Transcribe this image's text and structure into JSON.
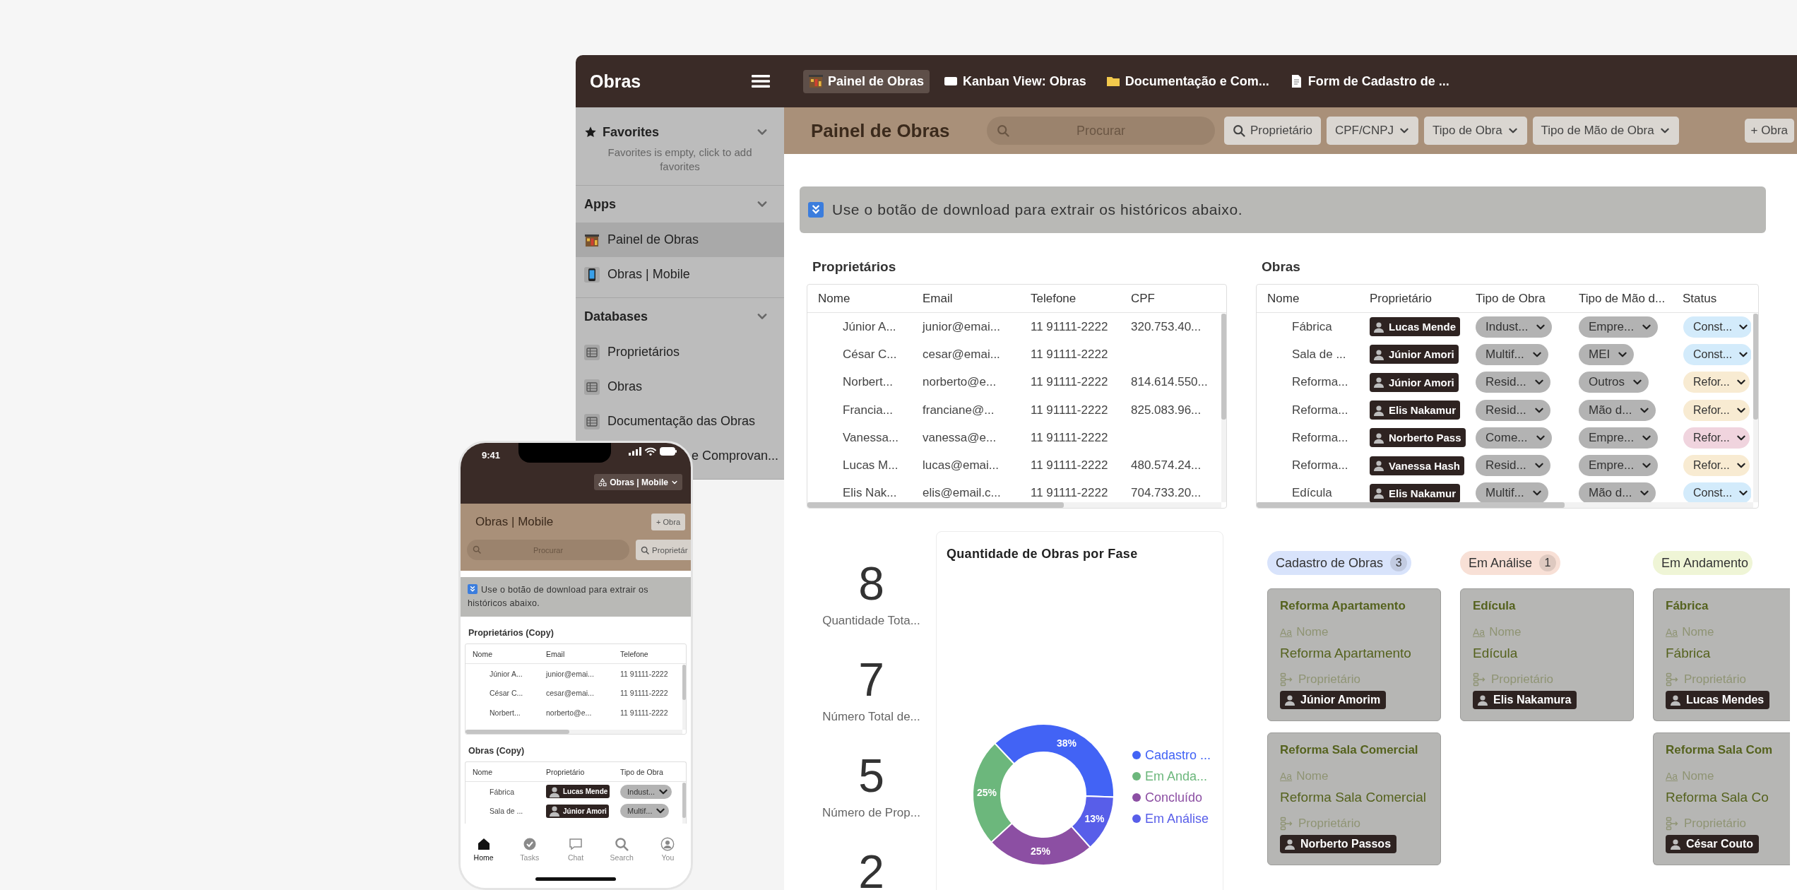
{
  "app": {
    "title": "Obras"
  },
  "tabs": [
    {
      "label": "Painel de Obras",
      "kind": "dashboard",
      "selected": true
    },
    {
      "label": "Kanban View: Obras",
      "kind": "board",
      "selected": false
    },
    {
      "label": "Documentação e Com...",
      "kind": "folder",
      "selected": false
    },
    {
      "label": "Form de Cadastro de ...",
      "kind": "form",
      "selected": false
    }
  ],
  "sidebar": {
    "sections": [
      {
        "title": "Favorites",
        "kind": "starred",
        "empty_text": "Favorites is empty, click to add favorites"
      },
      {
        "title": "Apps",
        "kind": "plain",
        "items": [
          {
            "label": "Painel de Obras",
            "kind": "dashboard",
            "selected": true
          },
          {
            "label": "Obras | Mobile",
            "kind": "phone",
            "selected": false
          }
        ]
      },
      {
        "title": "Databases",
        "kind": "plain",
        "items": [
          {
            "label": "Proprietários",
            "kind": "table",
            "selected": false
          },
          {
            "label": "Obras",
            "kind": "table",
            "selected": false
          },
          {
            "label": "Documentação das Obras",
            "kind": "table",
            "selected": false
          },
          {
            "label": "e Comprovan...",
            "kind": "partial",
            "selected": false
          }
        ]
      }
    ]
  },
  "header": {
    "title": "Painel de Obras",
    "search": {
      "placeholder": "Procurar"
    },
    "filters": [
      {
        "label": "Proprietário",
        "kind": "search"
      },
      {
        "label": "CPF/CNPJ",
        "kind": "dropdown"
      },
      {
        "label": "Tipo de Obra",
        "kind": "dropdown"
      },
      {
        "label": "Tipo de Mão de Obra",
        "kind": "dropdown"
      }
    ],
    "add_button": "+ Obra"
  },
  "banner": {
    "text": "Use o botão de download para extrair os históricos abaixo."
  },
  "owners_table": {
    "title": "Proprietários",
    "columns": [
      "Nome",
      "Email",
      "Telefone",
      "CPF"
    ],
    "rows": [
      {
        "nome": "Júnior A...",
        "email": "junior@emai...",
        "telefone": "11 91111-2222",
        "cpf": "320.753.40..."
      },
      {
        "nome": "César C...",
        "email": "cesar@emai...",
        "telefone": "11 91111-2222"
      },
      {
        "nome": "Norbert...",
        "email": "norberto@e...",
        "telefone": "11 91111-2222",
        "cpf": "814.614.550..."
      },
      {
        "nome": "Francia...",
        "email": "franciane@...",
        "telefone": "11 91111-2222",
        "cpf": "825.083.96..."
      },
      {
        "nome": "Vanessa...",
        "email": "vanessa@e...",
        "telefone": "11 91111-2222"
      },
      {
        "nome": "Lucas M...",
        "email": "lucas@emai...",
        "telefone": "11 91111-2222",
        "cpf": "480.574.24..."
      },
      {
        "nome": "Elis Nak...",
        "email": "elis@email.c...",
        "telefone": "11 91111-2222",
        "cpf": "704.733.20..."
      }
    ]
  },
  "works_table": {
    "title": "Obras",
    "columns": [
      "Nome",
      "Proprietário",
      "Tipo de Obra",
      "Tipo de Mão d...",
      "Status"
    ],
    "rows": [
      {
        "nome": "Fábrica",
        "proprietario": "Lucas Mende",
        "tipo_de_obra": "Indust...",
        "tipo_de_mao_de_obra": "Empre...",
        "status": {
          "label": "Const...",
          "color": "#d3ebfb"
        }
      },
      {
        "nome": "Sala de ...",
        "proprietario": "Júnior Amori",
        "tipo_de_obra": "Multif...",
        "tipo_de_mao_de_obra": "MEI",
        "status": {
          "label": "Const...",
          "color": "#d3ebfb"
        }
      },
      {
        "nome": "Reforma...",
        "proprietario": "Júnior Amori",
        "tipo_de_obra": "Resid...",
        "tipo_de_mao_de_obra": "Outros",
        "status": {
          "label": "Refor...",
          "color": "#f8ebd2"
        }
      },
      {
        "nome": "Reforma...",
        "proprietario": "Elis Nakamur",
        "tipo_de_obra": "Resid...",
        "tipo_de_mao_de_obra": "Mão d...",
        "status": {
          "label": "Refor...",
          "color": "#f8ebd2"
        }
      },
      {
        "nome": "Reforma...",
        "proprietario": "Norberto Pass",
        "tipo_de_obra": "Come...",
        "tipo_de_mao_de_obra": "Empre...",
        "status": {
          "label": "Refor...",
          "color": "#f0d4de"
        }
      },
      {
        "nome": "Reforma...",
        "proprietario": "Vanessa Hash",
        "tipo_de_obra": "Resid...",
        "tipo_de_mao_de_obra": "Empre...",
        "status": {
          "label": "Refor...",
          "color": "#f8ebd2"
        }
      },
      {
        "nome": "Edícula",
        "proprietario": "Elis Nakamur",
        "tipo_de_obra": "Multif...",
        "tipo_de_mao_de_obra": "Mão d...",
        "status": {
          "label": "Const...",
          "color": "#d3ebfb"
        }
      }
    ]
  },
  "stats": [
    {
      "value": "8",
      "label": "Quantidade Tota..."
    },
    {
      "value": "7",
      "label": "Número Total de..."
    },
    {
      "value": "5",
      "label": "Número de Prop..."
    },
    {
      "value": "2"
    }
  ],
  "chart": {
    "chart_data": {
      "type": "donut",
      "title": "Quantidade de Obras por Fase",
      "categories": [
        "Cadastro ...",
        "Em Anda...",
        "Concluído",
        "Em Análise"
      ],
      "values": [
        38,
        25,
        25,
        13
      ],
      "legend": "right",
      "colors": [
        "#4263f5",
        "#6cb77c",
        "#8c4fa3",
        "#585ee9"
      ],
      "value_labels": [
        "38%",
        "25%",
        "25%",
        "13%"
      ]
    }
  },
  "kanban": {
    "columns": [
      {
        "title": "Cadastro de Obras",
        "count": "3",
        "color": "#d8e3fb",
        "cards": [
          {
            "title": "Reforma Apartamento",
            "field_icon": "Aa",
            "field_label": "Nome",
            "field_value": "Reforma Apartamento",
            "owner_label": "Proprietário",
            "owner": "Júnior Amorim"
          },
          {
            "title": "Reforma Sala Comercial",
            "field_icon": "Aa",
            "field_label": "Nome",
            "field_value": "Reforma Sala Comercial",
            "owner_label": "Proprietário",
            "owner": "Norberto Passos"
          }
        ]
      },
      {
        "title": "Em Análise",
        "count": "1",
        "color": "#f8e0d6",
        "cards": [
          {
            "title": "Edícula",
            "field_icon": "Aa",
            "field_label": "Nome",
            "field_value": "Edícula",
            "owner_label": "Proprietário",
            "owner": "Elis Nakamura"
          }
        ]
      },
      {
        "title": "Em Andamento",
        "color": "#eff5d6",
        "cards": [
          {
            "title": "Fábrica",
            "field_icon": "Aa",
            "field_label": "Nome",
            "field_value": "Fábrica",
            "owner_label": "Proprietário",
            "owner": "Lucas Mendes"
          },
          {
            "title": "Reforma Sala Com",
            "field_icon": "Aa",
            "field_label": "Nome",
            "field_value": "Reforma Sala Co",
            "owner_label": "Proprietário",
            "owner": "César Couto"
          }
        ]
      }
    ]
  },
  "phone": {
    "time": "9:41",
    "app_switcher": "Obras | Mobile",
    "title": "Obras | Mobile",
    "add_button": "+ Obra",
    "search": {
      "placeholder": "Procurar"
    },
    "filter": "Proprietár",
    "banner": "Use o botão de download para extrair os históricos abaixo.",
    "owners_table": {
      "title": "Proprietários (Copy)",
      "columns": [
        "Nome",
        "Email",
        "Telefone"
      ],
      "rows": [
        {
          "nome": "Júnior A...",
          "email": "junior@emai...",
          "telefone": "11 91111-2222"
        },
        {
          "nome": "César C...",
          "email": "cesar@emai...",
          "telefone": "11 91111-2222"
        },
        {
          "nome": "Norbert...",
          "email": "norberto@e...",
          "telefone": "11 91111-2222"
        }
      ]
    },
    "works_table": {
      "title": "Obras (Copy)",
      "columns": [
        "Nome",
        "Proprietário",
        "Tipo de Obra"
      ],
      "rows": [
        {
          "nome": "Fábrica",
          "proprietario": "Lucas Mende",
          "tipo_de_obra": "Indust..."
        },
        {
          "nome": "Sala de ...",
          "proprietario": "Júnior Amori",
          "tipo_de_obra": "Multif..."
        }
      ]
    },
    "tab_bar": [
      {
        "label": "Home",
        "kind": "home",
        "selected": true
      },
      {
        "label": "Tasks",
        "kind": "check",
        "selected": false
      },
      {
        "label": "Chat",
        "kind": "chat",
        "selected": false
      },
      {
        "label": "Search",
        "kind": "search",
        "selected": false
      },
      {
        "label": "You",
        "kind": "person",
        "selected": false
      }
    ]
  }
}
